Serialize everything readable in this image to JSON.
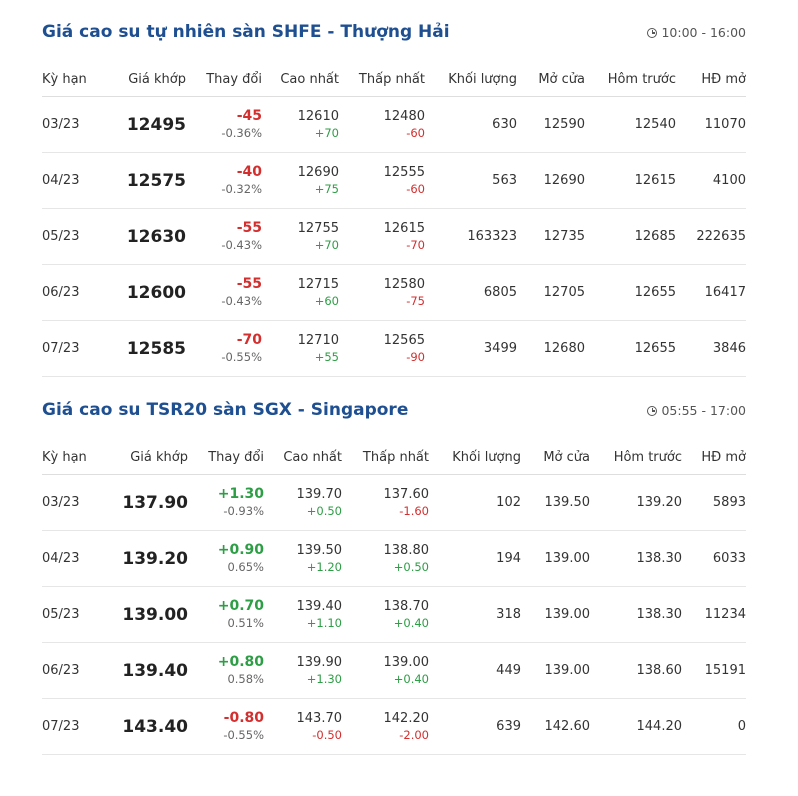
{
  "colors": {
    "title": "#1e4f91",
    "up": "#2e9e46",
    "down": "#d32f2f"
  },
  "columns": [
    "Kỳ hạn",
    "Giá khớp",
    "Thay đổi",
    "Cao nhất",
    "Thấp nhất",
    "Khối lượng",
    "Mở cửa",
    "Hôm trước",
    "HĐ mở"
  ],
  "sections": [
    {
      "title": "Giá cao su tự nhiên sàn SHFE - Thượng Hải",
      "time": "10:00 - 16:00",
      "rows": [
        {
          "term": "03/23",
          "price": "12495",
          "change": "-45",
          "pct": "-0.36%",
          "dir": "down",
          "high": "12610",
          "high_diff": "+70",
          "high_dir": "up",
          "low": "12480",
          "low_diff": "-60",
          "low_dir": "down",
          "volume": "630",
          "open": "12590",
          "prev": "12540",
          "oi": "11070"
        },
        {
          "term": "04/23",
          "price": "12575",
          "change": "-40",
          "pct": "-0.32%",
          "dir": "down",
          "high": "12690",
          "high_diff": "+75",
          "high_dir": "up",
          "low": "12555",
          "low_diff": "-60",
          "low_dir": "down",
          "volume": "563",
          "open": "12690",
          "prev": "12615",
          "oi": "4100"
        },
        {
          "term": "05/23",
          "price": "12630",
          "change": "-55",
          "pct": "-0.43%",
          "dir": "down",
          "high": "12755",
          "high_diff": "+70",
          "high_dir": "up",
          "low": "12615",
          "low_diff": "-70",
          "low_dir": "down",
          "volume": "163323",
          "open": "12735",
          "prev": "12685",
          "oi": "222635"
        },
        {
          "term": "06/23",
          "price": "12600",
          "change": "-55",
          "pct": "-0.43%",
          "dir": "down",
          "high": "12715",
          "high_diff": "+60",
          "high_dir": "up",
          "low": "12580",
          "low_diff": "-75",
          "low_dir": "down",
          "volume": "6805",
          "open": "12705",
          "prev": "12655",
          "oi": "16417"
        },
        {
          "term": "07/23",
          "price": "12585",
          "change": "-70",
          "pct": "-0.55%",
          "dir": "down",
          "high": "12710",
          "high_diff": "+55",
          "high_dir": "up",
          "low": "12565",
          "low_diff": "-90",
          "low_dir": "down",
          "volume": "3499",
          "open": "12680",
          "prev": "12655",
          "oi": "3846"
        }
      ]
    },
    {
      "title": "Giá cao su TSR20 sàn SGX - Singapore",
      "time": "05:55 - 17:00",
      "rows": [
        {
          "term": "03/23",
          "price": "137.90",
          "change": "+1.30",
          "pct": "-0.93%",
          "dir": "up",
          "high": "139.70",
          "high_diff": "+0.50",
          "high_dir": "up",
          "low": "137.60",
          "low_diff": "-1.60",
          "low_dir": "down",
          "volume": "102",
          "open": "139.50",
          "prev": "139.20",
          "oi": "5893"
        },
        {
          "term": "04/23",
          "price": "139.20",
          "change": "+0.90",
          "pct": "0.65%",
          "dir": "up",
          "high": "139.50",
          "high_diff": "+1.20",
          "high_dir": "up",
          "low": "138.80",
          "low_diff": "+0.50",
          "low_dir": "up",
          "volume": "194",
          "open": "139.00",
          "prev": "138.30",
          "oi": "6033"
        },
        {
          "term": "05/23",
          "price": "139.00",
          "change": "+0.70",
          "pct": "0.51%",
          "dir": "up",
          "high": "139.40",
          "high_diff": "+1.10",
          "high_dir": "up",
          "low": "138.70",
          "low_diff": "+0.40",
          "low_dir": "up",
          "volume": "318",
          "open": "139.00",
          "prev": "138.30",
          "oi": "11234"
        },
        {
          "term": "06/23",
          "price": "139.40",
          "change": "+0.80",
          "pct": "0.58%",
          "dir": "up",
          "high": "139.90",
          "high_diff": "+1.30",
          "high_dir": "up",
          "low": "139.00",
          "low_diff": "+0.40",
          "low_dir": "up",
          "volume": "449",
          "open": "139.00",
          "prev": "138.60",
          "oi": "15191"
        },
        {
          "term": "07/23",
          "price": "143.40",
          "change": "-0.80",
          "pct": "-0.55%",
          "dir": "down",
          "high": "143.70",
          "high_diff": "-0.50",
          "high_dir": "down",
          "low": "142.20",
          "low_diff": "-2.00",
          "low_dir": "down",
          "volume": "639",
          "open": "142.60",
          "prev": "144.20",
          "oi": "0"
        }
      ]
    }
  ]
}
